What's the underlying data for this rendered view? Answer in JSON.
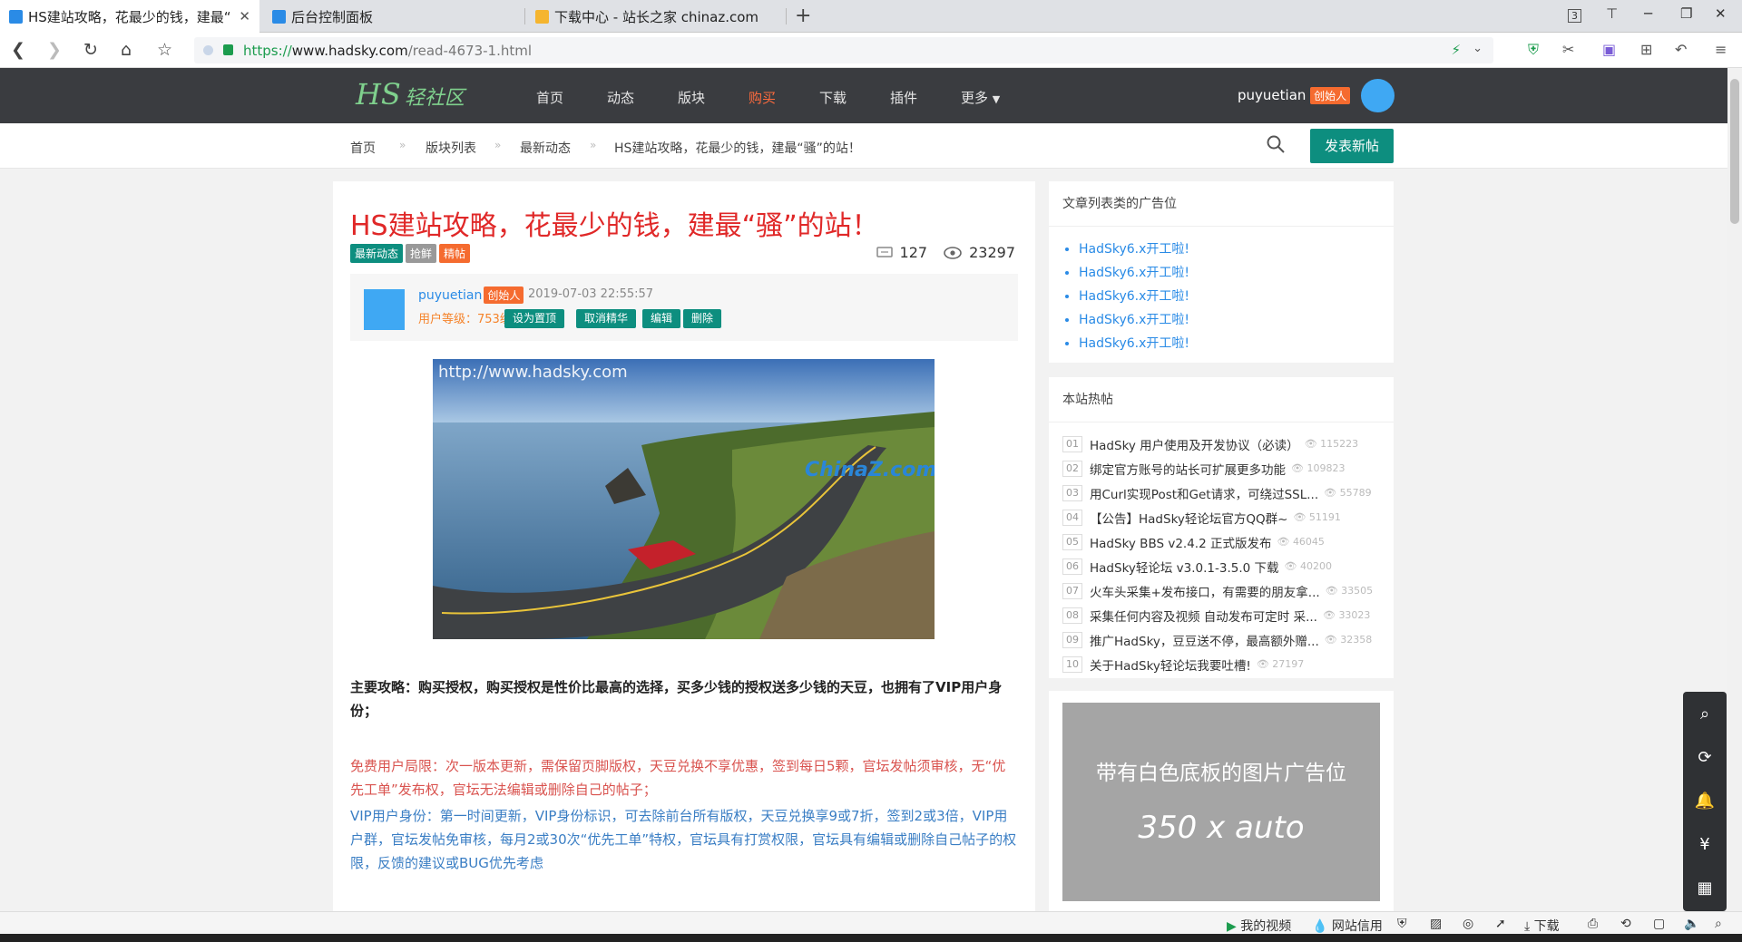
{
  "browser": {
    "tabs": [
      {
        "title": "HS建站攻略，花最少的钱，建最“",
        "active": true
      },
      {
        "title": "后台控制面板",
        "active": false
      },
      {
        "title": "下载中心 - 站长之家 chinaz.com",
        "active": false
      }
    ],
    "tab_count_badge": "3",
    "url": {
      "scheme": "https://",
      "host": "www.hadsky.com",
      "path": "/read-4673-1.html"
    }
  },
  "site": {
    "logo_main": "HS",
    "logo_sub": "轻社区",
    "nav": [
      "首页",
      "动态",
      "版块",
      "购买",
      "下载",
      "插件",
      "更多"
    ],
    "user": {
      "name": "puyuetian",
      "badge": "创始人"
    },
    "breadcrumb": [
      "首页",
      "版块列表",
      "最新动态",
      "HS建站攻略，花最少的钱，建最“骚”的站！"
    ],
    "post_button": "发表新帖"
  },
  "post": {
    "title": "HS建站攻略，花最少的钱，建最“骚”的站！",
    "tags": [
      {
        "label": "最新动态",
        "color": "#0d8e7f"
      },
      {
        "label": "抢鲜",
        "color": "#999999"
      },
      {
        "label": "精帖",
        "color": "#f56b2f"
      }
    ],
    "comments": "127",
    "views": "23297",
    "author": {
      "name": "puyuetian",
      "badge": "创始人",
      "time": "2019-07-03 22:55:57",
      "level": "用户等级：753级"
    },
    "actions": [
      "设为置顶",
      "取消精华",
      "编辑",
      "删除"
    ],
    "image_watermark": "http://www.hadsky.com",
    "image_watermark2": "ChinaZ.com",
    "para1": "主要攻略：购买授权，购买授权是性价比最高的选择，买多少钱的授权送多少钱的天豆，也拥有了VIP用户身份；",
    "para2": "免费用户局限：次一版本更新，需保留页脚版权，天豆兑换不享优惠，签到每日5颗，官坛发帖须审核，无“优先工单”发布权，官坛无法编辑或删除自己的帖子；",
    "para3": "VIP用户身份：第一时间更新，VIP身份标识，可去除前台所有版权，天豆兑换享9或7折，签到2或3倍，VIP用户群，官坛发帖免审核，每月2或30次“优先工单”特权，官坛具有打赏权限，官坛具有编辑或删除自己帖子的权限，反馈的建议或BUG优先考虑"
  },
  "sidebar": {
    "ad_title": "文章列表类的广告位",
    "ad_items": [
      "HadSky6.x开工啦!",
      "HadSky6.x开工啦!",
      "HadSky6.x开工啦!",
      "HadSky6.x开工啦!",
      "HadSky6.x开工啦!"
    ],
    "hot_title": "本站热帖",
    "hot_items": [
      {
        "num": "01",
        "title": "HadSky 用户使用及开发协议（必读）",
        "views": "115223"
      },
      {
        "num": "02",
        "title": "绑定官方账号的站长可扩展更多功能",
        "views": "109823"
      },
      {
        "num": "03",
        "title": "用Curl实现Post和Get请求，可绕过SSL...",
        "views": "55789"
      },
      {
        "num": "04",
        "title": "【公告】HadSky轻论坛官方QQ群~",
        "views": "51191"
      },
      {
        "num": "05",
        "title": "HadSky BBS v2.4.2 正式版发布",
        "views": "46045"
      },
      {
        "num": "06",
        "title": "HadSky轻论坛 v3.0.1-3.5.0 下载",
        "views": "40200"
      },
      {
        "num": "07",
        "title": "火车头采集+发布接口，有需要的朋友拿...",
        "views": "33505"
      },
      {
        "num": "08",
        "title": "采集任何内容及视频 自动发布可定时 采...",
        "views": "33023"
      },
      {
        "num": "09",
        "title": "推广HadSky，豆豆送不停，最高额外赠...",
        "views": "32358"
      },
      {
        "num": "10",
        "title": "关于HadSky轻论坛我要吐槽!",
        "views": "27197"
      }
    ],
    "banner_line1": "带有白色底板的图片广告位",
    "banner_line2": "350 x auto"
  },
  "statusbar": [
    "我的视频",
    "网站信用",
    "下载"
  ]
}
